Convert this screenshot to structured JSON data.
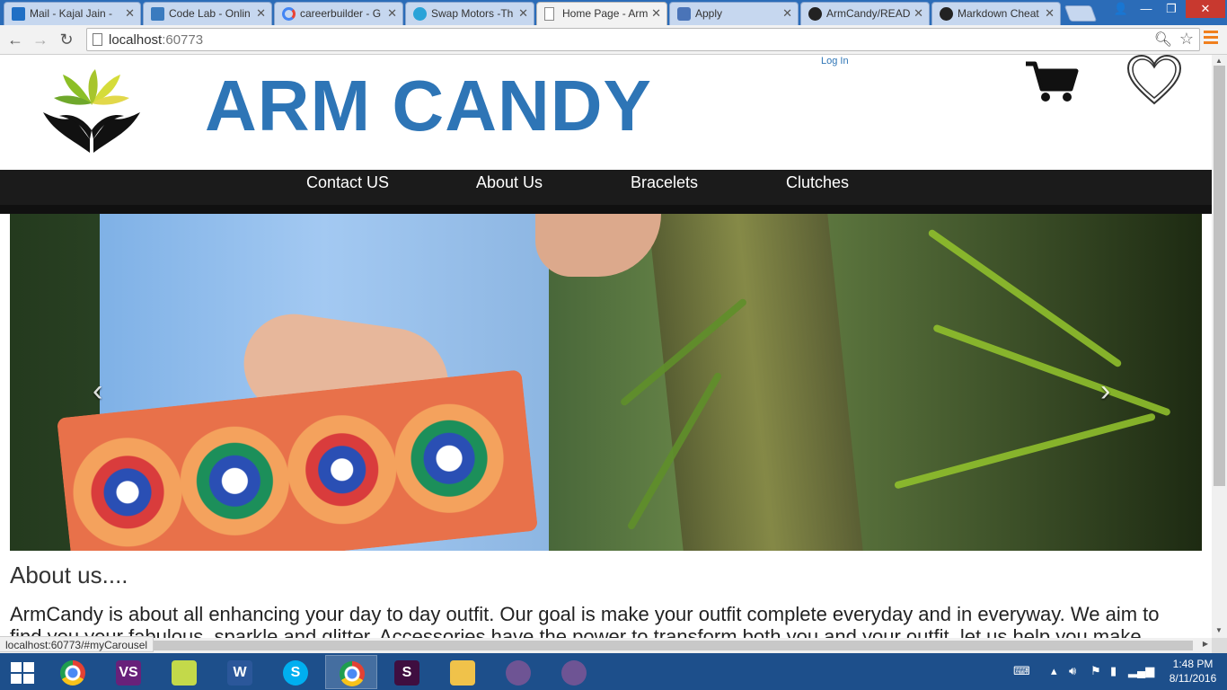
{
  "browser": {
    "tabs": [
      {
        "label": "Mail - Kajal Jain -",
        "icon": "outlook-icon",
        "active": false
      },
      {
        "label": "Code Lab - Onlin",
        "icon": "codelab-icon",
        "active": false
      },
      {
        "label": "careerbuilder - G",
        "icon": "google-icon",
        "active": false
      },
      {
        "label": "Swap Motors -Th",
        "icon": "swap-icon",
        "active": false
      },
      {
        "label": "Home Page - Arm",
        "icon": "page-icon",
        "active": true
      },
      {
        "label": "Apply",
        "icon": "apply-icon",
        "active": false
      },
      {
        "label": "ArmCandy/READ",
        "icon": "github-icon",
        "active": false
      },
      {
        "label": "Markdown Cheat",
        "icon": "github-icon",
        "active": false
      }
    ],
    "url_host": "localhost",
    "url_port": ":60773",
    "status_url": "localhost:60773/#myCarousel"
  },
  "site": {
    "brand": "ARM CANDY",
    "login_label": "Log In",
    "nav": [
      "Contact US",
      "About Us",
      "Bracelets",
      "Clutches"
    ],
    "about_heading": "About us....",
    "about_text": "ArmCandy is about all enhancing your day to day outfit. Our goal is make your outfit complete everyday and in everyway. We aim to find you your fabulous, sparkle and glitter. Accessories have the power to transform both you and your outfit, let us help you make",
    "carousel_prev": "‹",
    "carousel_next": "›",
    "brand_color": "#2e75b6"
  },
  "taskbar": {
    "apps": [
      {
        "name": "chrome",
        "icon": "chrome-icon",
        "glyph": "",
        "color": "#e34133",
        "active": false
      },
      {
        "name": "visual-studio",
        "icon": "visual-studio-icon",
        "glyph": "VS",
        "color": "#68217a",
        "active": false
      },
      {
        "name": "sticky-notes",
        "icon": "sticky-notes-icon",
        "glyph": "",
        "color": "#c3d94a",
        "active": false
      },
      {
        "name": "word",
        "icon": "word-icon",
        "glyph": "W",
        "color": "#2b579a",
        "active": false
      },
      {
        "name": "skype",
        "icon": "skype-icon",
        "glyph": "S",
        "color": "#00aff0",
        "active": false
      },
      {
        "name": "chrome-active",
        "icon": "chrome-icon",
        "glyph": "",
        "color": "#e34133",
        "active": true
      },
      {
        "name": "slack",
        "icon": "slack-icon",
        "glyph": "S",
        "color": "#3f0e40",
        "active": false
      },
      {
        "name": "file-explorer",
        "icon": "folder-icon",
        "glyph": "",
        "color": "#f0c24a",
        "active": false
      },
      {
        "name": "github-desktop-1",
        "icon": "github-cat-icon",
        "glyph": "",
        "color": "#6e5494",
        "active": false
      },
      {
        "name": "github-desktop-2",
        "icon": "github-cat-icon",
        "glyph": "",
        "color": "#6e5494",
        "active": false
      }
    ],
    "time": "1:48 PM",
    "date": "8/11/2016"
  }
}
